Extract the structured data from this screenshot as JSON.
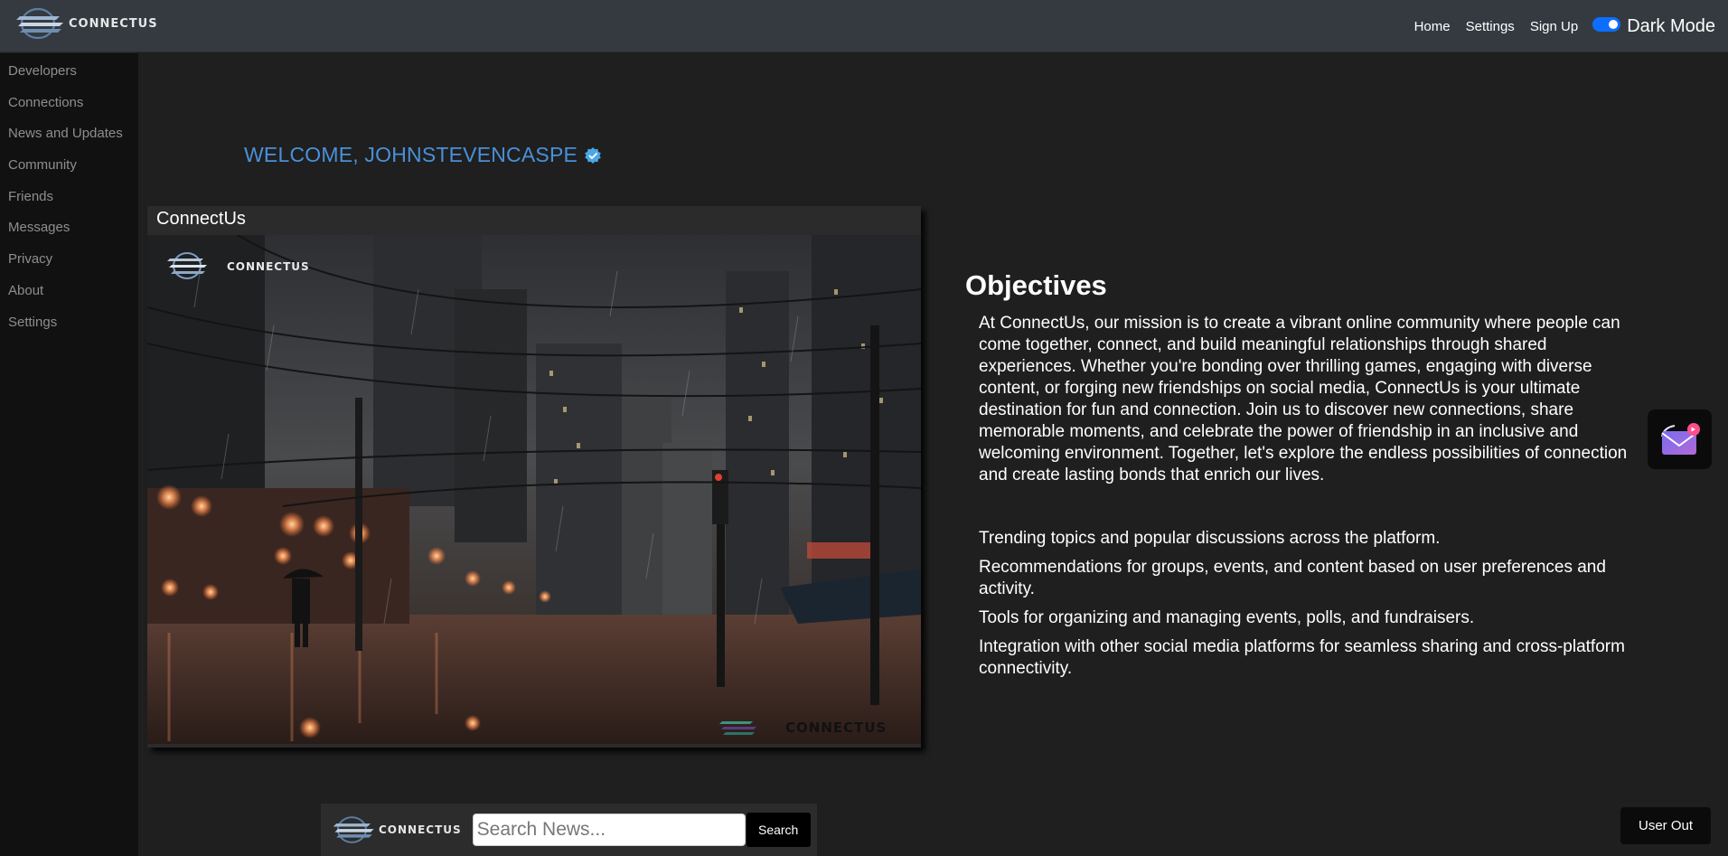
{
  "brand": {
    "name": "CONNECTUS",
    "logo_icon": "connectus-logo-icon"
  },
  "nav": {
    "items": [
      {
        "label": "Home"
      },
      {
        "label": "Settings"
      },
      {
        "label": "Sign Up"
      }
    ],
    "dark_mode_label": "Dark Mode",
    "dark_mode_on": true
  },
  "sidebar": {
    "items": [
      {
        "label": "Developers"
      },
      {
        "label": "Connections"
      },
      {
        "label": "News and Updates"
      },
      {
        "label": "Community"
      },
      {
        "label": "Friends"
      },
      {
        "label": "Messages"
      },
      {
        "label": "Privacy"
      },
      {
        "label": "About"
      },
      {
        "label": "Settings"
      }
    ]
  },
  "welcome": {
    "text": "WELCOME, JOHNSTEVENCASPE",
    "verified_icon": "verified-badge-icon"
  },
  "card": {
    "title": "ConnectUs",
    "image_logo_text": "CONNECTUS",
    "image_watermark_text": "CONNECTUS"
  },
  "objectives": {
    "title": "Objectives",
    "text": "At ConnectUs, our mission is to create a vibrant online community where people can come together, connect, and build meaningful relationships through shared experiences. Whether you're bonding over thrilling games, engaging with diverse content, or forging new friendships on social media, ConnectUs is your ultimate destination for fun and connection. Join us to discover new connections, share memorable moments, and celebrate the power of friendship in an inclusive and welcoming environment. Together, let's explore the endless possibilities of connection and create lasting bonds that enrich our lives.",
    "features": [
      "Trending topics and popular discussions across the platform.",
      "Recommendations for groups, events, and content based on user preferences and activity.",
      "Tools for organizing and managing events, polls, and fundraisers.",
      "Integration with other social media platforms for seamless sharing and cross-platform connectivity."
    ]
  },
  "floating": {
    "mail_icon": "mail-icon"
  },
  "search": {
    "brand": "CONNECTUS",
    "placeholder": "Search News...",
    "value": "",
    "button_label": "Search"
  },
  "user_out_label": "User Out",
  "colors": {
    "topbar": "#343a40",
    "sidebar": "#111111",
    "background": "#1f1f1f",
    "welcome": "#4a90d9",
    "toggle": "#0d6efd"
  }
}
